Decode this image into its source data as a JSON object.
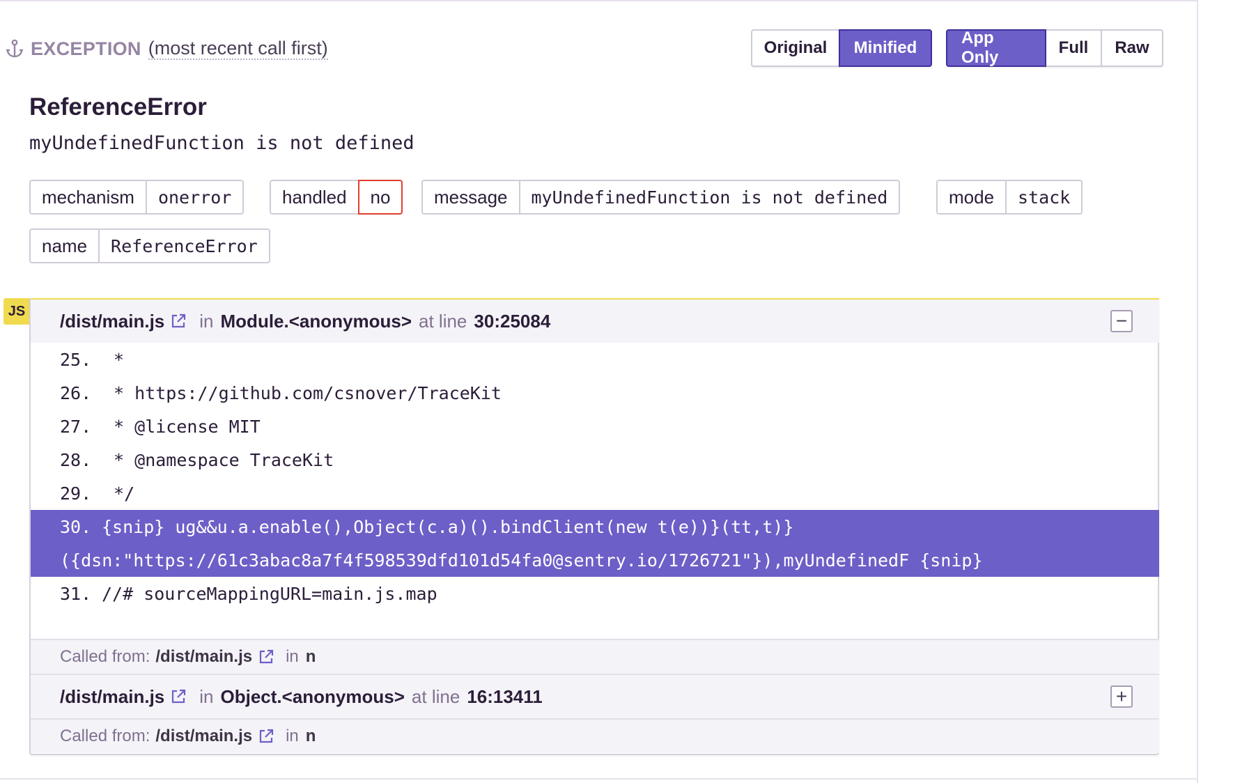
{
  "header": {
    "title": "EXCEPTION",
    "subtitle": "(most recent call first)",
    "anchor_icon": "anchor-icon"
  },
  "view_toggle": {
    "original": "Original",
    "minified": "Minified",
    "active": "Minified"
  },
  "stack_toggle": {
    "app_only": "App Only",
    "full": "Full",
    "raw": "Raw",
    "active": "App Only"
  },
  "error": {
    "type": "ReferenceError",
    "message": "myUndefinedFunction is not defined"
  },
  "tags": [
    {
      "key": "mechanism",
      "value": "onerror"
    },
    {
      "key": "handled",
      "value": "no"
    },
    {
      "key": "message",
      "value": "myUndefinedFunction is not defined"
    },
    {
      "key": "mode",
      "value": "stack"
    },
    {
      "key": "name",
      "value": "ReferenceError"
    }
  ],
  "platform_badge": "JS",
  "frames": [
    {
      "file": "/dist/main.js",
      "in_label": "in",
      "function": "Module.<anonymous>",
      "at_line_label": "at line",
      "line": "30:25084",
      "toggle": "−",
      "code": [
        {
          "num": "25.",
          "text": " *"
        },
        {
          "num": "26.",
          "text": " * https://github.com/csnover/TraceKit"
        },
        {
          "num": "27.",
          "text": " * @license MIT"
        },
        {
          "num": "28.",
          "text": " * @namespace TraceKit"
        },
        {
          "num": "29.",
          "text": " */"
        },
        {
          "num": "30.",
          "text": "{snip} ug&&u.a.enable(),Object(c.a)().bindClient(new t(e))}(tt,t)}"
        },
        {
          "num": "",
          "text": "({dsn:\"https://61c3abac8a7f4f598539dfd101d54fa0@sentry.io/1726721\"}),myUndefinedF {snip}"
        },
        {
          "num": "31.",
          "text": "//# sourceMappingURL=main.js.map"
        }
      ],
      "called_from_label": "Called from:",
      "called_from_file": "/dist/main.js",
      "called_from_in": "in",
      "called_from_fn": "n"
    },
    {
      "file": "/dist/main.js",
      "in_label": "in",
      "function": "Object.<anonymous>",
      "at_line_label": "at line",
      "line": "16:13411",
      "toggle": "+",
      "called_from_label": "Called from:",
      "called_from_file": "/dist/main.js",
      "called_from_in": "in",
      "called_from_fn": "n"
    }
  ],
  "colors": {
    "accent": "#6c5fc7",
    "js_badge": "#f0db4f",
    "handled_no": "#e03e2f"
  }
}
